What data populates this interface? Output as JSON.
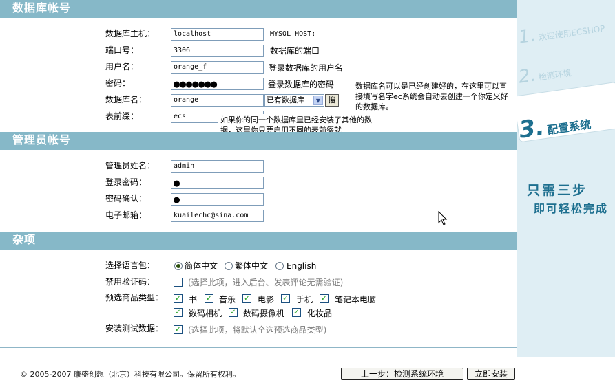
{
  "sections": {
    "db": "数据库帐号",
    "admin": "管理员帐号",
    "misc": "杂项"
  },
  "db": {
    "host_label": "数据库主机：",
    "host_value": "localhost",
    "host_note": "MYSQL HOST:",
    "port_label": "端口号：",
    "port_value": "3306",
    "port_note": "数据库的端口",
    "user_label": "用户名：",
    "user_value": "orange_f",
    "user_note": "登录数据库的用户名",
    "pass_label": "密码：",
    "pass_value": "●●●●●●●",
    "pass_note": "登录数据库的密码",
    "name_label": "数据库名：",
    "name_value": "orange",
    "name_select": "已有数据库",
    "search_button": "搜",
    "name_note": "数据库名可以是已经创建好的，在这里可以直接填写名字ec系统会自动去创建一个你定义好的数据库。",
    "prefix_label": "表前缀：",
    "prefix_value": "ecs_",
    "prefix_tip": "如果你的同一个数据库里已经安装了其他的数据，这里你只要启用不同的表前缀就"
  },
  "admin": {
    "name_label": "管理员姓名：",
    "name_value": "admin",
    "pass_label": "登录密码：",
    "pass_value": "●",
    "confirm_label": "密码确认：",
    "confirm_value": "●",
    "email_label": "电子邮箱：",
    "email_value": "kuailechc@sina.com"
  },
  "misc": {
    "lang_label": "选择语言包：",
    "lang_options": [
      "简体中文",
      "繁体中文",
      "English"
    ],
    "lang_selected": "简体中文",
    "captcha_label": "禁用验证码：",
    "captcha_note": "(选择此项，进入后台、发表评论无需验证)",
    "captcha_checked": false,
    "goods_label": "预选商品类型：",
    "goods_types": [
      "书",
      "音乐",
      "电影",
      "手机",
      "笔记本电脑",
      "数码相机",
      "数码摄像机",
      "化妆品"
    ],
    "test_label": "安装测试数据：",
    "test_note": "(选择此项，将默认全选预选商品类型)",
    "test_checked": true
  },
  "sidebar": {
    "step1_num": "1.",
    "step1": "欢迎使用ECSHOP",
    "step2_num": "2.",
    "step2": "检测环境",
    "step3_num": "3.",
    "step3": "配置系统",
    "slogan1": "只需三步",
    "slogan2": "即可轻松完成"
  },
  "footer": {
    "copyright": "© 2005-2007 康盛创想（北京）科技有限公司。保留所有权利。",
    "prev_button": "上一步：检测系统环境",
    "install_button": "立即安装"
  },
  "colors": {
    "band": "#86b8c8",
    "sidebar_bg": "#dfeef4",
    "active_step": "#1d6f8f"
  }
}
